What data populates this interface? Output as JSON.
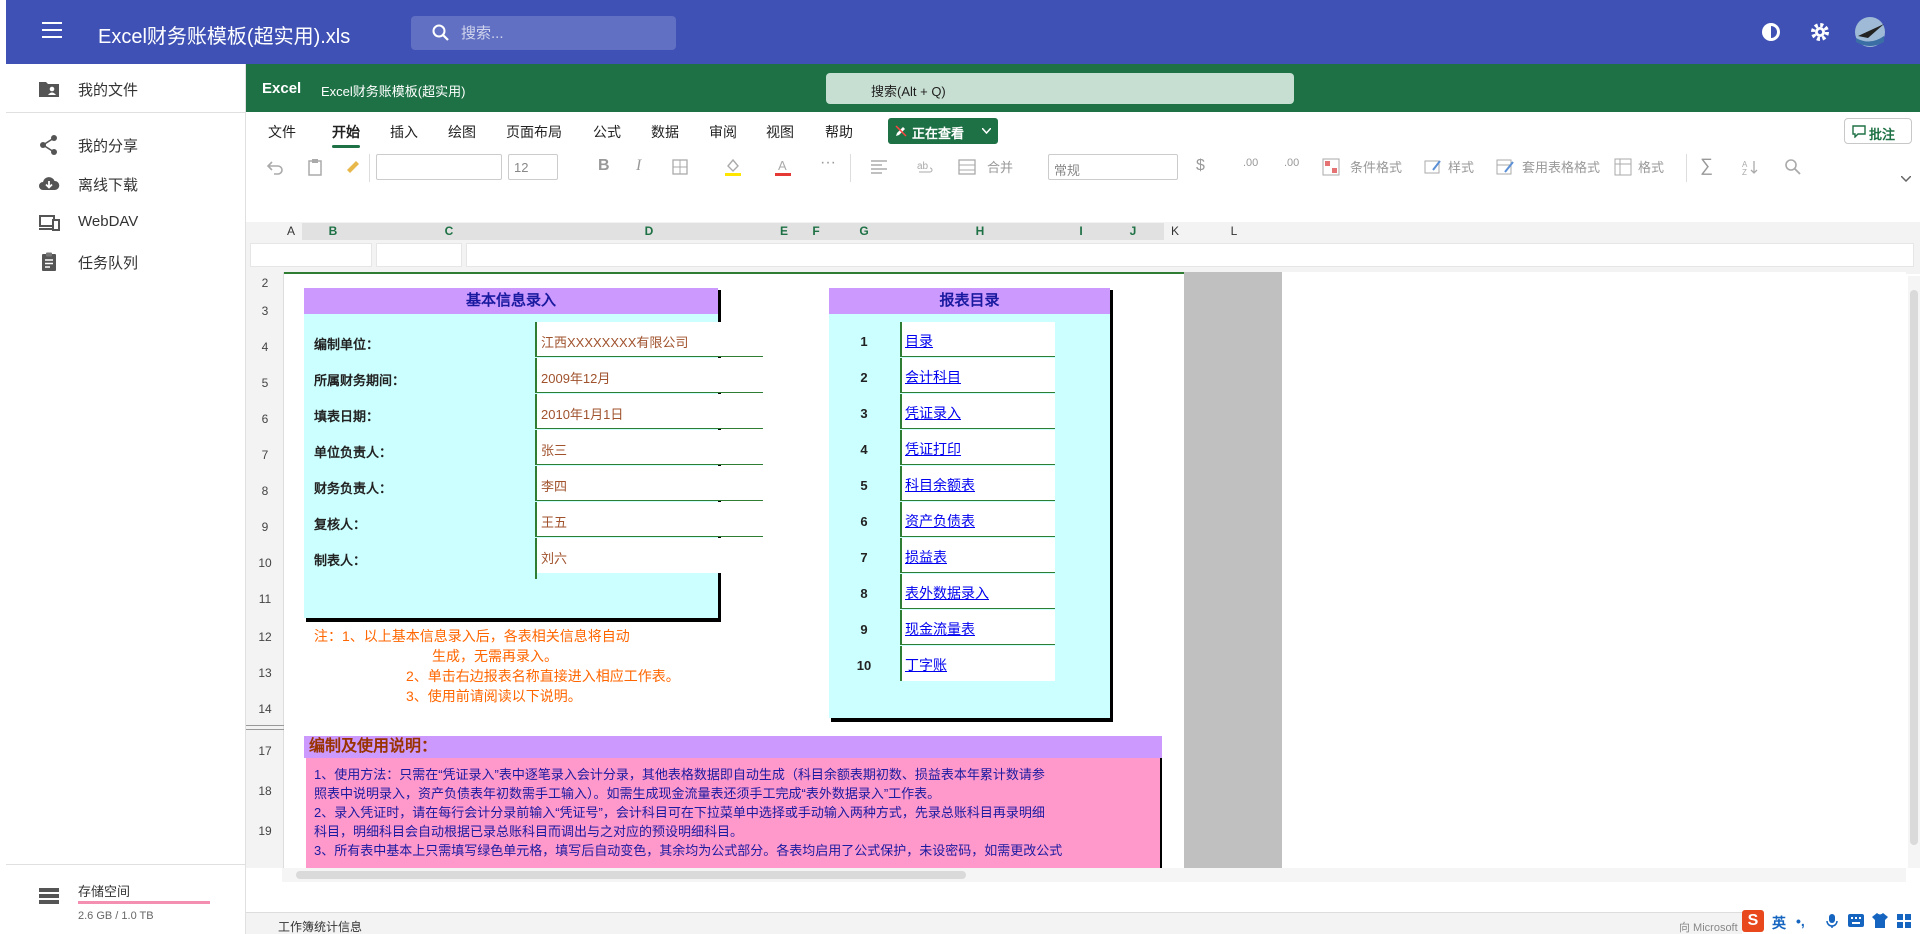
{
  "app": {
    "title": "Excel财务账模板(超实用).xls",
    "search_placeholder": "搜索..."
  },
  "sidebar": {
    "items": [
      {
        "label": "我的文件",
        "icon": "folder-user-icon"
      },
      {
        "label": "我的分享",
        "icon": "share-icon"
      },
      {
        "label": "离线下载",
        "icon": "cloud-download-icon"
      },
      {
        "label": "WebDAV",
        "icon": "devices-icon"
      },
      {
        "label": "任务队列",
        "icon": "clipboard-icon"
      }
    ],
    "storage": {
      "label": "存储空间",
      "value": "2.6 GB / 1.0 TB",
      "used_fraction": 0.0025
    }
  },
  "excel": {
    "brand": "Excel",
    "file_name": "Excel财务账模板(超实用)",
    "search_label": "搜索(Alt + Q)",
    "tabs": [
      "文件",
      "开始",
      "插入",
      "绘图",
      "页面布局",
      "公式",
      "数据",
      "审阅",
      "视图",
      "帮助"
    ],
    "active_tab": "开始",
    "viewing_label": "正在查看",
    "comment_label": "批注",
    "toolbar": {
      "font_size": "12",
      "merge": "合并",
      "number_format": "常规",
      "currency": "$",
      "cond_format": "条件格式",
      "styles": "样式",
      "table_format": "套用表格格式",
      "format": "格式"
    },
    "columns": [
      "A",
      "B",
      "C",
      "D",
      "E",
      "F",
      "G",
      "H",
      "I",
      "J",
      "K",
      "L"
    ],
    "rows": [
      "2",
      "3",
      "4",
      "5",
      "6",
      "7",
      "8",
      "9",
      "10",
      "11",
      "12",
      "13",
      "14",
      "17",
      "18",
      "19"
    ],
    "status_text": "工作簿统计信息",
    "microsoft_text": "向 Microsoft"
  },
  "sheet": {
    "info_title": "基本信息录入",
    "info": [
      {
        "label": "编制单位：",
        "value": "江西XXXXXXXX有限公司"
      },
      {
        "label": "所属财务期间：",
        "value": "2009年12月"
      },
      {
        "label": "填表日期：",
        "value": "2010年1月1日"
      },
      {
        "label": "单位负责人：",
        "value": "张三"
      },
      {
        "label": "财务负责人：",
        "value": "李四"
      },
      {
        "label": "复核人：",
        "value": "王五"
      },
      {
        "label": "制表人：",
        "value": "刘六"
      }
    ],
    "notes": [
      "注：1、以上基本信息录入后，各表相关信息将自动",
      "生成，无需再录入。",
      "2、单击右边报表名称直接进入相应工作表。",
      "3、使用前请阅读以下说明。"
    ],
    "catalog_title": "报表目录",
    "catalog": [
      {
        "no": "1",
        "name": "目录"
      },
      {
        "no": "2",
        "name": "会计科目"
      },
      {
        "no": "3",
        "name": "凭证录入"
      },
      {
        "no": "4",
        "name": "凭证打印"
      },
      {
        "no": "5",
        "name": "科目余额表"
      },
      {
        "no": "6",
        "name": "资产负债表"
      },
      {
        "no": "7",
        "name": "损益表"
      },
      {
        "no": "8",
        "name": "表外数据录入"
      },
      {
        "no": "9",
        "name": "现金流量表"
      },
      {
        "no": "10",
        "name": "丁字账"
      }
    ],
    "instructions_title": "编制及使用说明：",
    "instructions": [
      "1、使用方法：只需在“凭证录入”表中逐笔录入会计分录，其他表格数据即自动生成（科目余额表期初数、损益表本年累计数请参",
      "照表中说明录入，资产负债表年初数需手工输入）。如需生成现金流量表还须手工完成“表外数据录入”工作表。",
      "2、录入凭证时，请在每行会计分录前输入“凭证号”，会计科目可在下拉菜单中选择或手动输入两种方式，先录总账科目再录明细",
      "科目，明细科目会自动根据已录总账科目而调出与之对应的预设明细科目。",
      "3、所有表中基本上只需填写绿色单元格，填写后自动变色，其余均为公式部分。各表均启用了公式保护，未设密码，如需更改公式"
    ]
  },
  "ime": {
    "logo": "S",
    "lang": "英"
  }
}
